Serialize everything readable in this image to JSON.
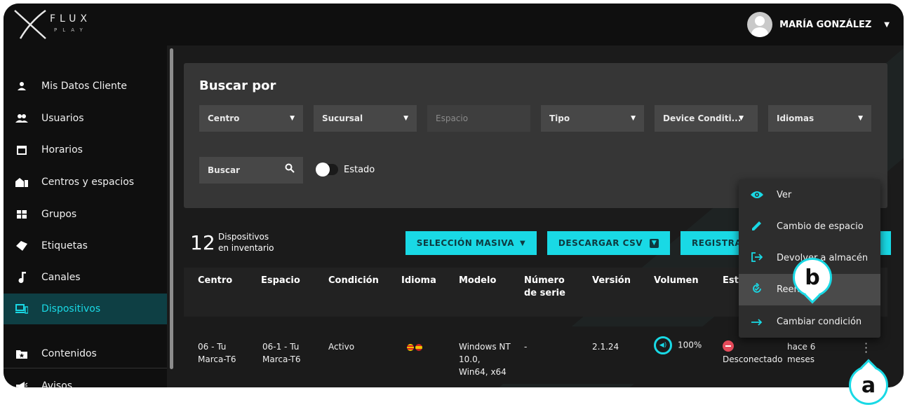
{
  "brand": {
    "word": "FLUX",
    "sub": "PLAY"
  },
  "user": {
    "name": "MARÍA GONZÁLEZ"
  },
  "sidebar": {
    "items": [
      {
        "label": "Mis Datos Cliente",
        "icon": "person-icon"
      },
      {
        "label": "Usuarios",
        "icon": "people-icon"
      },
      {
        "label": "Horarios",
        "icon": "calendar-icon"
      },
      {
        "label": "Centros y espacios",
        "icon": "building-icon"
      },
      {
        "label": "Grupos",
        "icon": "grid-icon"
      },
      {
        "label": "Etiquetas",
        "icon": "tag-icon"
      },
      {
        "label": "Canales",
        "icon": "music-note-icon"
      },
      {
        "label": "Dispositivos",
        "icon": "devices-icon",
        "active": true
      },
      {
        "label": "Contenidos",
        "icon": "folder-star-icon"
      },
      {
        "label": "Avisos",
        "icon": "megaphone-icon"
      }
    ]
  },
  "search": {
    "title": "Buscar por",
    "filters": [
      {
        "label": "Centro"
      },
      {
        "label": "Sucursal"
      },
      {
        "label": "Espacio",
        "placeholder": true
      },
      {
        "label": "Tipo"
      },
      {
        "label": "Device Conditi..."
      },
      {
        "label": "Idiomas"
      }
    ],
    "search_label": "Buscar",
    "toggle_label": "Estado"
  },
  "summary": {
    "count": "12",
    "label_line1": "Dispositivos",
    "label_line2": "en inventario"
  },
  "actions": {
    "bulk": "SELECCIÓN MASIVA",
    "csv": "DESCARGAR CSV",
    "register": "REGISTRAR"
  },
  "table": {
    "headers": [
      "Centro",
      "Espacio",
      "Condición",
      "Idioma",
      "Modelo",
      "Número de serie",
      "Versión",
      "Volumen",
      "Esta"
    ],
    "row": {
      "centro": "06 - Tu Marca-T6",
      "espacio": "06-1 - Tu Marca-T6",
      "condicion": "Activo",
      "modelo": "Windows NT 10.0, Win64, x64",
      "serie": "-",
      "version": "2.1.24",
      "volumen": "100%",
      "estado": "Desconectado",
      "ultimo": "hace 6 meses"
    }
  },
  "menu": {
    "items": [
      {
        "label": "Ver",
        "icon": "eye-icon"
      },
      {
        "label": "Cambio de espacio",
        "icon": "pencil-icon"
      },
      {
        "label": "Devolver a almacén",
        "icon": "exit-icon"
      },
      {
        "label": "Reenviar",
        "icon": "refresh-icon",
        "highlight": true
      },
      {
        "label": "Cambiar condición",
        "icon": "arrow-right-icon"
      }
    ]
  },
  "callouts": {
    "a": "a",
    "b": "b"
  },
  "colors": {
    "accent": "#19d9e5",
    "danger": "#e54a5a",
    "panel": "#363636"
  }
}
